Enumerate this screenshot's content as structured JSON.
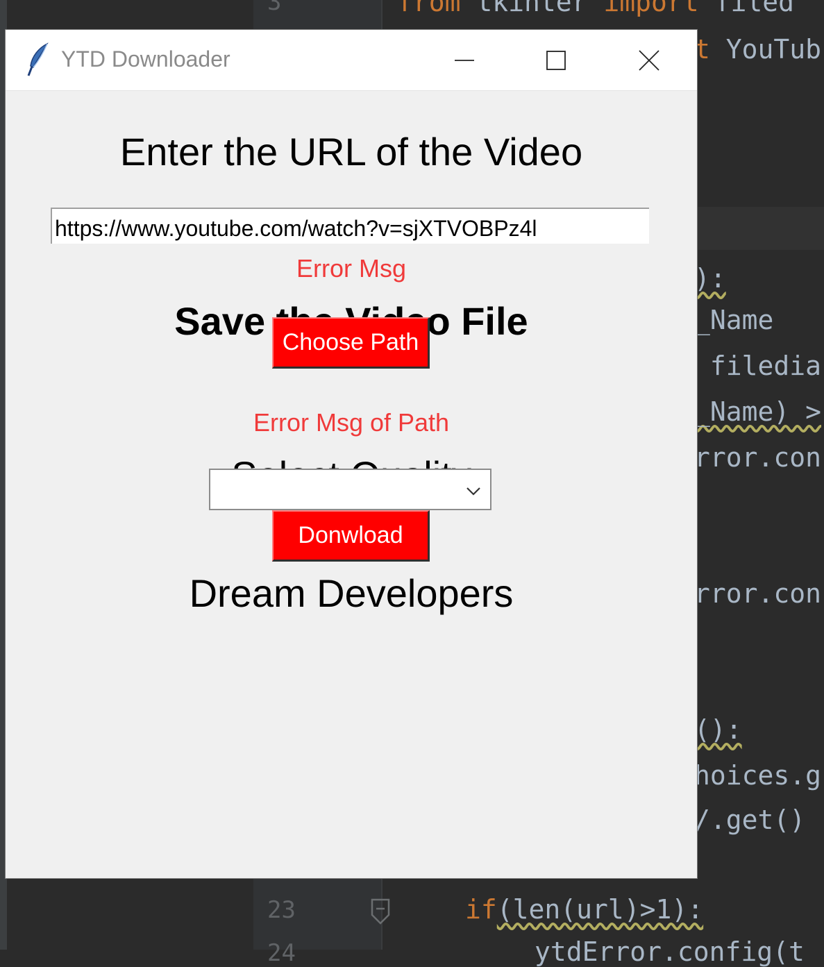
{
  "window": {
    "title": "YTD Downloader",
    "controls": [
      "minimize-icon",
      "maximize-icon",
      "close-icon"
    ]
  },
  "form": {
    "url_heading": "Enter the URL of the Video",
    "url_value": "https://www.youtube.com/watch?v=sjXTVOBPz4l",
    "url_error": "Error Msg",
    "save_heading": "Save the Video File",
    "choose_path_label": "Choose Path",
    "path_error": "Error Msg of Path",
    "quality_heading": "Select Quality",
    "quality_selected": "",
    "download_label": "Donwload",
    "credit": "Dream Developers"
  },
  "ide": {
    "lines": [
      {
        "part1": "from",
        "part2": " tkinter ",
        "part3": "import",
        "part4": " filed"
      },
      {
        "part1": "t",
        "part2": " YouTub"
      },
      {
        "text": "):"
      },
      {
        "text": "_Name"
      },
      {
        "text": " filedia"
      },
      {
        "text": "_Name) >"
      },
      {
        "text": "rror.con"
      },
      {
        "text": "rror.con"
      },
      {
        "text": "():"
      },
      {
        "text": "hoices.g"
      },
      {
        "text": "/.get()"
      },
      {
        "kw": "if",
        "rest": "(len(url)>1):"
      },
      {
        "text": "ytdError.config(t"
      }
    ],
    "line_numbers": [
      "3",
      "23",
      "24"
    ]
  },
  "colors": {
    "button_bg": "#ff0000",
    "error_text": "#f03a3a",
    "window_bg": "#f0f0f0",
    "ide_bg": "#2b2b2b",
    "keyword": "#cc7832"
  }
}
